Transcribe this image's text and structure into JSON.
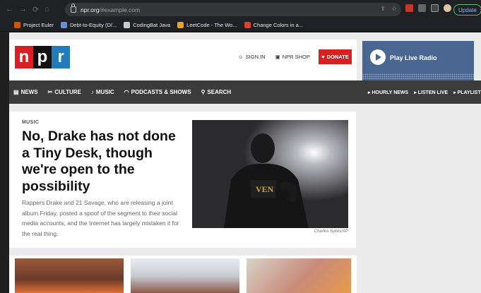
{
  "browser": {
    "url_host": "npr.org",
    "url_path": "/#example.com",
    "update_label": "Update",
    "bookmarks": [
      {
        "label": "Project Euler",
        "color": "#d35400"
      },
      {
        "label": "Debt-to-Equity (D/...",
        "color": "#6a8ed8"
      },
      {
        "label": "CodingBat Java",
        "color": "#cccccc"
      },
      {
        "label": "LeetCode - The Wo...",
        "color": "#f0a020"
      },
      {
        "label": "Change Colors in a...",
        "color": "#e04030"
      }
    ]
  },
  "header": {
    "logo": [
      "n",
      "p",
      "r"
    ],
    "logo_colors": [
      "#d62021",
      "#111111",
      "#237bbd"
    ],
    "sign_in": "SIGN IN",
    "shop": "NPR SHOP",
    "donate": "DONATE"
  },
  "radio": {
    "title": "Play Live Radio",
    "links": [
      "HOURLY NEWS",
      "LISTEN LIVE",
      "PLAYLIST"
    ]
  },
  "nav": {
    "items": [
      {
        "label": "NEWS",
        "icon": "newspaper-icon"
      },
      {
        "label": "CULTURE",
        "icon": "culture-icon"
      },
      {
        "label": "MUSIC",
        "icon": "music-note-icon"
      },
      {
        "label": "PODCASTS & SHOWS",
        "icon": "headphones-icon"
      },
      {
        "label": "SEARCH",
        "icon": "search-icon"
      }
    ]
  },
  "article": {
    "kicker": "MUSIC",
    "headline": "No, Drake has not done a Tiny Desk, though we're open to the possibility",
    "teaser": "Rappers Drake and 21 Savage, who are releasing a joint album Friday, posted a spoof of the segment to their social media accounts, and the Internet has largely mistaken it for the real thing.",
    "photo_credit": "Charles Sykes/AP"
  }
}
